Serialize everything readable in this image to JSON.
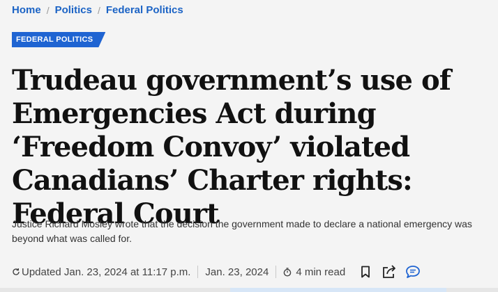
{
  "breadcrumb": {
    "items": [
      "Home",
      "Politics",
      "Federal Politics"
    ],
    "separator": "/"
  },
  "section_tag": "FEDERAL POLITICS",
  "headline": "Trudeau government’s use of Emergencies Act during ‘Freedom Convoy’ violated Canadians’ Charter rights: Federal Court",
  "dek": "Justice Richard Mosley wrote that the decision the government made to declare a national emergency was beyond what was called for.",
  "meta": {
    "updated": "Updated Jan. 23, 2024 at 11:17 p.m.",
    "published": "Jan. 23, 2024",
    "read_time": "4 min read"
  },
  "icons": {
    "updated": "refresh-icon",
    "read_time": "timer-icon",
    "bookmark": "bookmark-icon",
    "share": "share-icon",
    "comments": "comment-icon"
  },
  "colors": {
    "link": "#1b63c5",
    "tag_bg": "#1f64d2",
    "comment_icon": "#1f64d2",
    "background": "#f4f4f4"
  }
}
